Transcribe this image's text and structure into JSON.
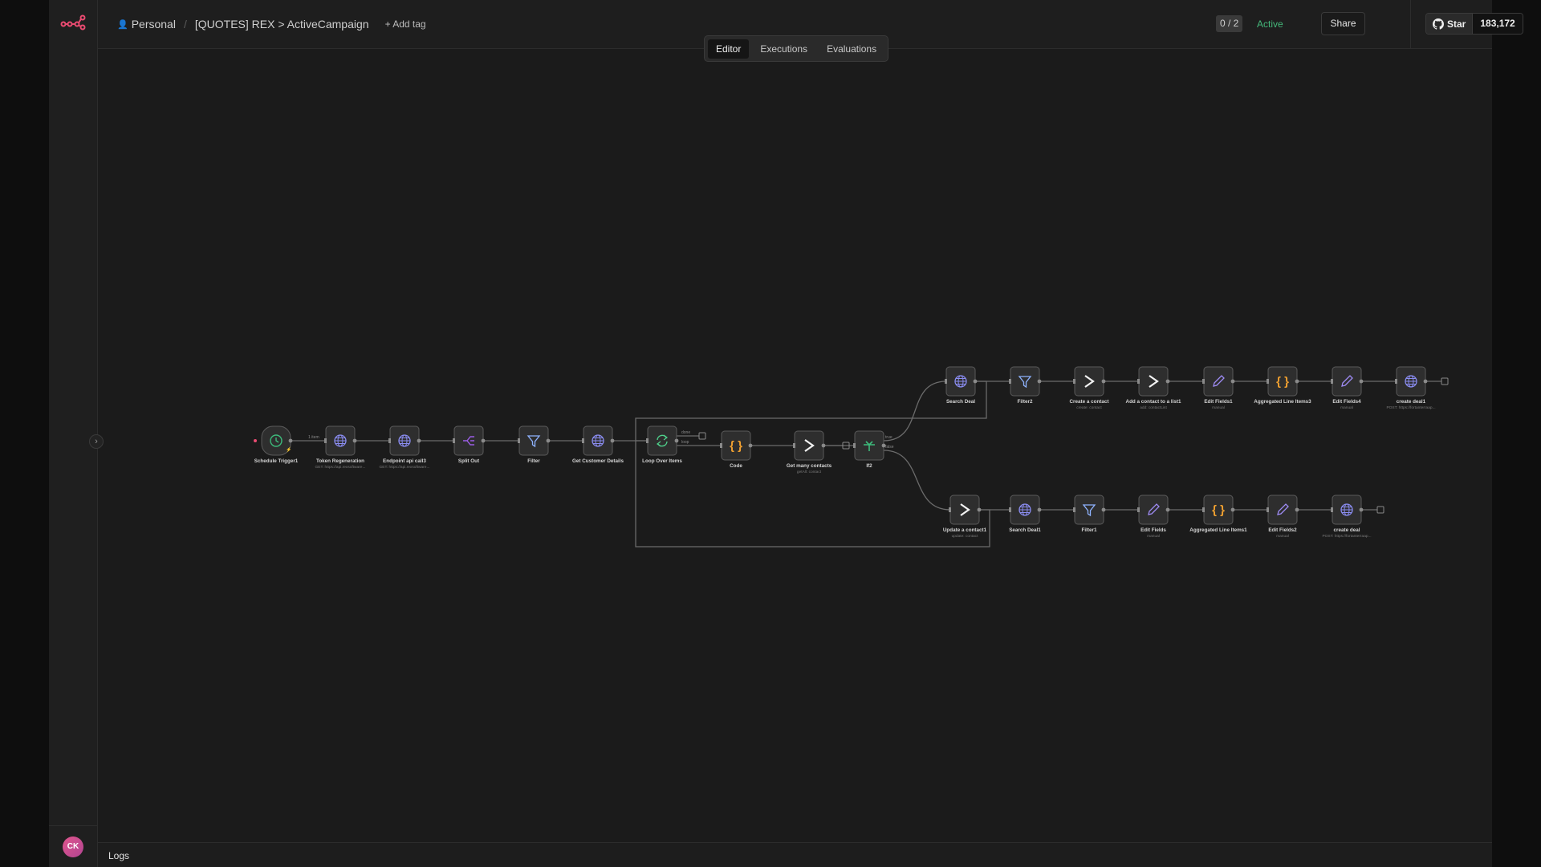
{
  "header": {
    "project": "Personal",
    "workflow_name": "[QUOTES] REX > ActiveCampaign",
    "add_tag_label": "+ Add tag",
    "version": "0 / 2",
    "status": "Active",
    "share_label": "Share",
    "star_label": "Star",
    "star_count": "183,172"
  },
  "tabs": [
    {
      "label": "Editor",
      "active": true
    },
    {
      "label": "Executions",
      "active": false
    },
    {
      "label": "Evaluations",
      "active": false
    }
  ],
  "user": {
    "initials": "CK"
  },
  "logs_label": "Logs",
  "colors": {
    "brand": "#ea4b71",
    "active_status": "#44b87a",
    "node_fill": "#2e2e2e",
    "node_border": "#5a5a5a",
    "edge": "#6b6b6b",
    "icon_globe": "#8a8cf0",
    "icon_split": "#9b5de5",
    "icon_code": "#f0a030",
    "icon_trigger": "#3dbb7b"
  },
  "edge_labels": {
    "trigger_items": "1 item",
    "loop_done": "done",
    "loop_loop": "loop",
    "if_true": "true",
    "if_false": "false"
  },
  "nodes": [
    {
      "id": "schedule-trigger",
      "name": "Schedule Trigger1",
      "icon": "clock-icon",
      "subtitle": ""
    },
    {
      "id": "token-regeneration",
      "name": "Token Regeneration",
      "icon": "globe-icon",
      "subtitle": "GET: https://api.rexsoftware..."
    },
    {
      "id": "endpoint-api-call3",
      "name": "Endpoint api call3",
      "icon": "globe-icon",
      "subtitle": "GET: https://api.rexsoftware..."
    },
    {
      "id": "split-out",
      "name": "Split Out",
      "icon": "split-icon",
      "subtitle": ""
    },
    {
      "id": "filter",
      "name": "Filter",
      "icon": "filter-icon",
      "subtitle": ""
    },
    {
      "id": "get-customer-details",
      "name": "Get Customer Details",
      "icon": "globe-icon",
      "subtitle": ""
    },
    {
      "id": "loop-over-items",
      "name": "Loop Over Items",
      "icon": "loop-icon",
      "subtitle": ""
    },
    {
      "id": "code",
      "name": "Code",
      "icon": "code-icon",
      "subtitle": ""
    },
    {
      "id": "get-many-contacts",
      "name": "Get many contacts",
      "icon": "chevron-icon",
      "subtitle": "getAll: contact"
    },
    {
      "id": "if2",
      "name": "If2",
      "icon": "if-icon",
      "subtitle": ""
    },
    {
      "id": "search-deal",
      "name": "Search Deal",
      "icon": "globe-icon",
      "subtitle": ""
    },
    {
      "id": "filter2",
      "name": "Filter2",
      "icon": "filter-icon",
      "subtitle": ""
    },
    {
      "id": "create-a-contact",
      "name": "Create a contact",
      "icon": "chevron-icon",
      "subtitle": "create: contact"
    },
    {
      "id": "add-contact-to-list1",
      "name": "Add a contact to a list1",
      "icon": "chevron-icon",
      "subtitle": "add: contactList"
    },
    {
      "id": "edit-fields1",
      "name": "Edit Fields1",
      "icon": "pencil-icon",
      "subtitle": "manual"
    },
    {
      "id": "aggregated-line-items3",
      "name": "Aggregated Line Items3",
      "icon": "code-icon",
      "subtitle": ""
    },
    {
      "id": "edit-fields4",
      "name": "Edit Fields4",
      "icon": "pencil-icon",
      "subtitle": "manual"
    },
    {
      "id": "create-deal1",
      "name": "create deal1",
      "icon": "globe-icon",
      "subtitle": "POST: https://fortanterraap..."
    },
    {
      "id": "update-a-contact1",
      "name": "Update a contact1",
      "icon": "chevron-icon",
      "subtitle": "update: contact"
    },
    {
      "id": "search-deal1",
      "name": "Search Deal1",
      "icon": "globe-icon",
      "subtitle": ""
    },
    {
      "id": "filter1",
      "name": "Filter1",
      "icon": "filter-icon",
      "subtitle": ""
    },
    {
      "id": "edit-fields",
      "name": "Edit Fields",
      "icon": "pencil-icon",
      "subtitle": "manual"
    },
    {
      "id": "aggregated-line-items1",
      "name": "Aggregated Line Items1",
      "icon": "code-icon",
      "subtitle": ""
    },
    {
      "id": "edit-fields2",
      "name": "Edit Fields2",
      "icon": "pencil-icon",
      "subtitle": "manual"
    },
    {
      "id": "create-deal",
      "name": "create deal",
      "icon": "globe-icon",
      "subtitle": "POST: https://fortanterraap..."
    }
  ]
}
